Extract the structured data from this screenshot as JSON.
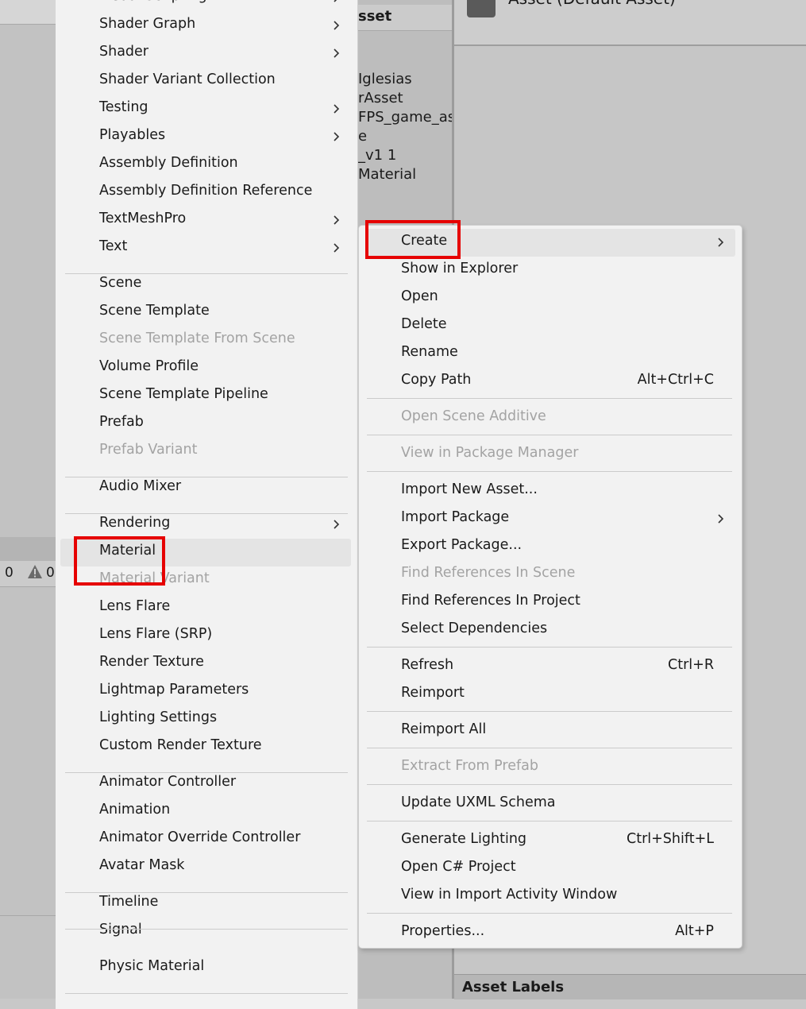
{
  "background": {
    "project_header": "sset",
    "project_items": [
      "Iglesias",
      "rAsset",
      "FPS_game_ass",
      "e",
      "_v1 1",
      "Material"
    ],
    "inspector_title": "Asset (Default Asset)",
    "asset_labels": "Asset Labels",
    "console": {
      "errors": "0",
      "warnings": "0"
    }
  },
  "create_menu": {
    "items": [
      {
        "label": "Visual Scripting",
        "submenu": true
      },
      {
        "label": "Shader Graph",
        "submenu": true
      },
      {
        "label": "Shader",
        "submenu": true
      },
      {
        "label": "Shader Variant Collection"
      },
      {
        "label": "Testing",
        "submenu": true
      },
      {
        "label": "Playables",
        "submenu": true
      },
      {
        "label": "Assembly Definition"
      },
      {
        "label": "Assembly Definition Reference"
      },
      {
        "label": "TextMeshPro",
        "submenu": true
      },
      {
        "label": "Text",
        "submenu": true
      },
      {
        "label": "Scene"
      },
      {
        "label": "Scene Template"
      },
      {
        "label": "Scene Template From Scene",
        "disabled": true
      },
      {
        "label": "Volume Profile"
      },
      {
        "label": "Scene Template Pipeline"
      },
      {
        "label": "Prefab"
      },
      {
        "label": "Prefab Variant",
        "disabled": true
      },
      {
        "label": "Audio Mixer"
      },
      {
        "label": "Rendering",
        "submenu": true
      },
      {
        "label": "Material",
        "highlighted": true
      },
      {
        "label": "Material Variant",
        "disabled": true
      },
      {
        "label": "Lens Flare"
      },
      {
        "label": "Lens Flare (SRP)"
      },
      {
        "label": "Render Texture"
      },
      {
        "label": "Lightmap Parameters"
      },
      {
        "label": "Lighting Settings"
      },
      {
        "label": "Custom Render Texture"
      },
      {
        "label": "Animator Controller"
      },
      {
        "label": "Animation"
      },
      {
        "label": "Animator Override Controller"
      },
      {
        "label": "Avatar Mask"
      },
      {
        "label": "Timeline"
      },
      {
        "label": "Signal"
      },
      {
        "label": "Physic Material"
      }
    ]
  },
  "context_menu": {
    "items": [
      {
        "label": "Create",
        "submenu": true,
        "highlighted": true
      },
      {
        "label": "Show in Explorer"
      },
      {
        "label": "Open"
      },
      {
        "label": "Delete"
      },
      {
        "label": "Rename"
      },
      {
        "label": "Copy Path",
        "shortcut": "Alt+Ctrl+C"
      },
      {
        "label": "Open Scene Additive",
        "disabled": true
      },
      {
        "label": "View in Package Manager",
        "disabled": true
      },
      {
        "label": "Import New Asset..."
      },
      {
        "label": "Import Package",
        "submenu": true
      },
      {
        "label": "Export Package..."
      },
      {
        "label": "Find References In Scene",
        "disabled": true
      },
      {
        "label": "Find References In Project"
      },
      {
        "label": "Select Dependencies"
      },
      {
        "label": "Refresh",
        "shortcut": "Ctrl+R"
      },
      {
        "label": "Reimport"
      },
      {
        "label": "Reimport All"
      },
      {
        "label": "Extract From Prefab",
        "disabled": true
      },
      {
        "label": "Update UXML Schema"
      },
      {
        "label": "Generate Lighting",
        "shortcut": "Ctrl+Shift+L"
      },
      {
        "label": "Open C# Project"
      },
      {
        "label": "View in Import Activity Window"
      },
      {
        "label": "Properties...",
        "shortcut": "Alt+P"
      }
    ]
  },
  "colors": {
    "highlight_box": "#e60000",
    "menu_bg": "#f2f2f2",
    "disabled_text": "#a3a3a3"
  }
}
